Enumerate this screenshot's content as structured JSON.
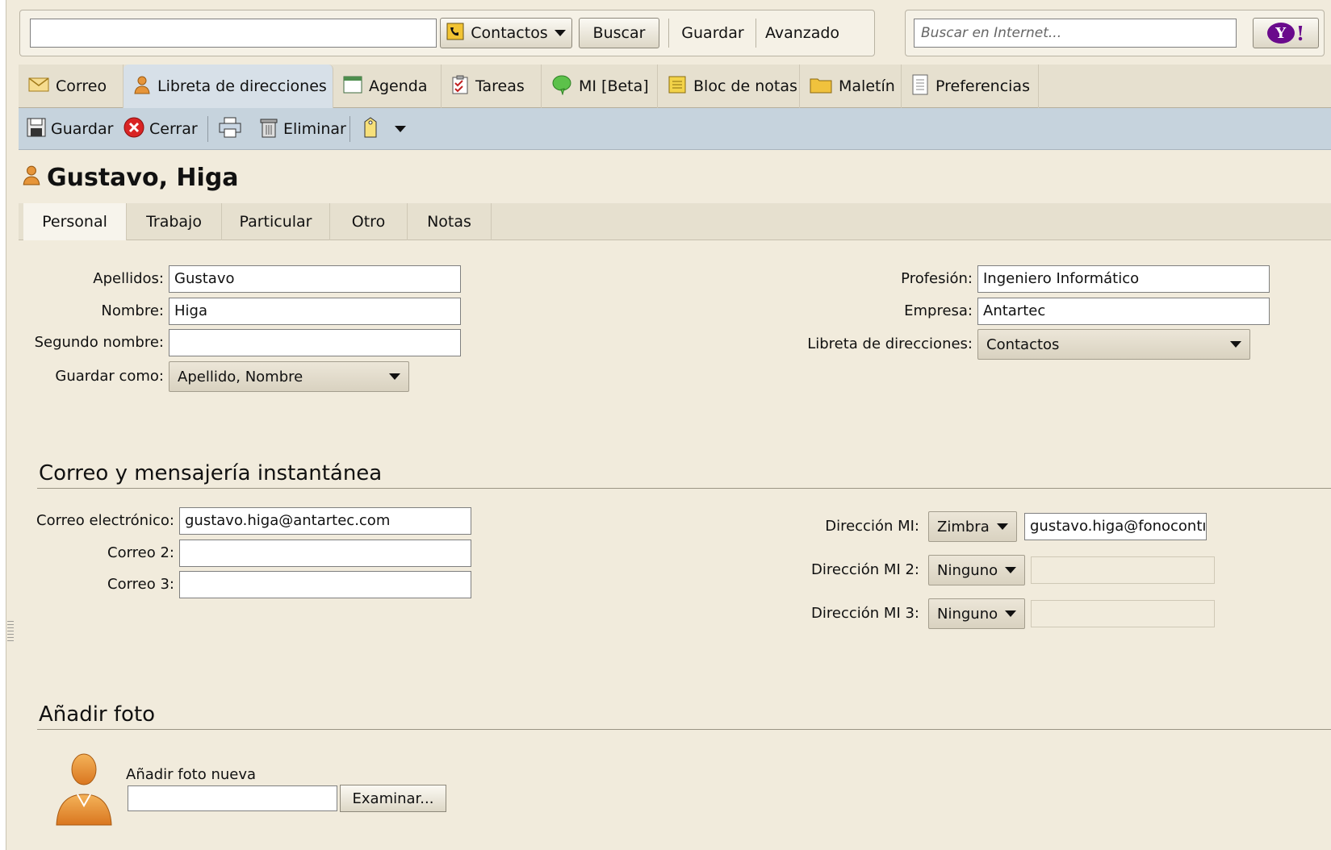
{
  "topbar": {
    "search_value": "",
    "search_scope": "Contactos",
    "search_button": "Buscar",
    "save_button": "Guardar",
    "advanced_button": "Avanzado",
    "web_search_placeholder": "Buscar en Internet...",
    "yahoo_label": "Y!"
  },
  "app_tabs": [
    {
      "label": "Correo",
      "icon": "mail-icon"
    },
    {
      "label": "Libreta de direcciones",
      "icon": "contact-icon",
      "active": true
    },
    {
      "label": "Agenda",
      "icon": "calendar-icon"
    },
    {
      "label": "Tareas",
      "icon": "tasks-icon"
    },
    {
      "label": "MI [Beta]",
      "icon": "chat-icon"
    },
    {
      "label": "Bloc de notas",
      "icon": "notebook-icon"
    },
    {
      "label": "Maletín",
      "icon": "briefcase-icon"
    },
    {
      "label": "Preferencias",
      "icon": "preferences-icon"
    }
  ],
  "toolbar": {
    "save": "Guardar",
    "close": "Cerrar",
    "delete": "Eliminar"
  },
  "contact": {
    "title": "Gustavo, Higa"
  },
  "section_tabs": [
    "Personal",
    "Trabajo",
    "Particular",
    "Otro",
    "Notas"
  ],
  "personal": {
    "last_name_label": "Apellidos:",
    "last_name": "Gustavo",
    "first_name_label": "Nombre:",
    "first_name": "Higa",
    "middle_name_label": "Segundo nombre:",
    "middle_name": "",
    "file_as_label": "Guardar como:",
    "file_as": "Apellido, Nombre",
    "profession_label": "Profesión:",
    "profession": "Ingeniero Informático",
    "company_label": "Empresa:",
    "company": "Antartec",
    "address_book_label": "Libreta de direcciones:",
    "address_book": "Contactos"
  },
  "email_section": {
    "heading": "Correo y mensajería instantánea",
    "email_label": "Correo electrónico:",
    "email": "gustavo.higa@antartec.com",
    "email2_label": "Correo 2:",
    "email2": "",
    "email3_label": "Correo 3:",
    "email3": "",
    "im_label": "Dirección MI:",
    "im_service": "Zimbra",
    "im_address": "gustavo.higa@fonocontı",
    "im2_label": "Dirección MI 2:",
    "im2_service": "Ninguno",
    "im3_label": "Dirección MI 3:",
    "im3_service": "Ninguno"
  },
  "photo_section": {
    "heading": "Añadir foto",
    "new_photo_label": "Añadir foto nueva",
    "browse_button": "Examinar..."
  }
}
